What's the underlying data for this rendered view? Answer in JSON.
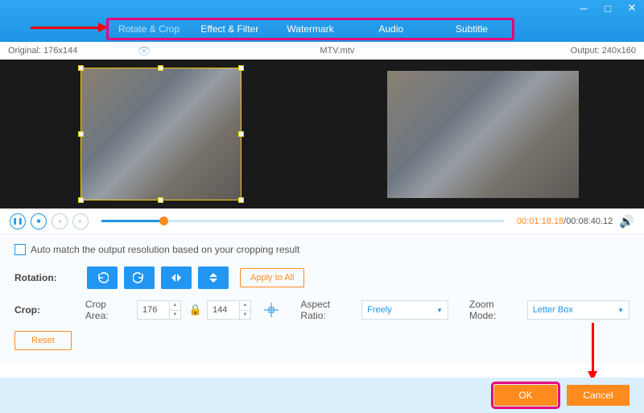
{
  "tabs": [
    "Rotate & Crop",
    "Effect & Filter",
    "Watermark",
    "Audio",
    "Subtitle"
  ],
  "info": {
    "original": "Original: 176x144",
    "filename": "MTV.mtv",
    "output": "Output: 240x160"
  },
  "playback": {
    "current": "00:01:18.18",
    "total": "00:08:40.12"
  },
  "auto_match": "Auto match the output resolution based on your cropping result",
  "rotation_label": "Rotation:",
  "apply_all": "Apply to All",
  "crop_label": "Crop:",
  "crop_area": "Crop Area:",
  "width": "176",
  "height": "144",
  "aspect_label": "Aspect Ratio:",
  "aspect_value": "Freely",
  "zoom_label": "Zoom Mode:",
  "zoom_value": "Letter Box",
  "reset": "Reset",
  "ok": "OK",
  "cancel": "Cancel"
}
